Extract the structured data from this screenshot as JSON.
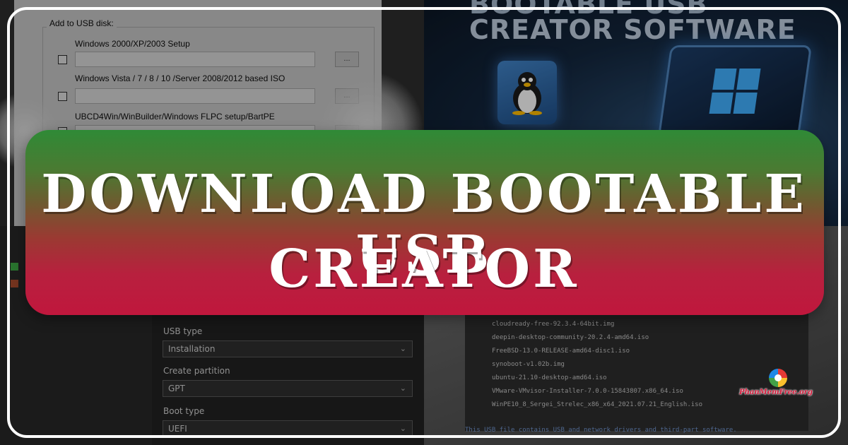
{
  "usb_disk_panel": {
    "group_title": "Add to USB disk:",
    "options": [
      {
        "label": "Windows 2000/XP/2003 Setup",
        "browse": "..."
      },
      {
        "label": "Windows Vista / 7 / 8 / 10 /Server 2008/2012 based ISO",
        "browse": "..."
      },
      {
        "label": "UBCD4Win/WinBuilder/Windows FLPC setup/BartPE",
        "browse": "..."
      }
    ]
  },
  "promo": {
    "title_top": "BOOTABLE USB",
    "title": "CREATOR SOFTWARE",
    "icons": [
      "linux-tux-icon",
      "windows-logo-icon"
    ]
  },
  "settings_panel": {
    "usb_type_label": "USB type",
    "usb_type_value": "Installation",
    "partition_label": "Create partition",
    "partition_value": "GPT",
    "boot_type_label": "Boot type",
    "boot_type_value": "UEFI",
    "legend_colors": {
      "green": "#3aa040",
      "brown": "#a0482c"
    }
  },
  "file_list": {
    "items": [
      "cloudready-free-92.3.4-64bit.img",
      "deepin-desktop-community-20.2.4-amd64.iso",
      "FreeBSD-13.0-RELEASE-amd64-disc1.iso",
      "synoboot-v1.02b.img",
      "ubuntu-21.10-desktop-amd64.iso",
      "VMware-VMvisor-Installer-7.0.0-15843807.x86_64.iso",
      "WinPE10_8_Sergei_Strelec_x86_x64_2021.07.21_English.iso"
    ],
    "footer": "This USB file contains USB and network drivers and third-part software."
  },
  "banner": {
    "line1": "DOWNLOAD BOOTABLE USB",
    "line2": "CREATOR",
    "gradient_top": "#2f8a36",
    "gradient_bottom": "#c0173d"
  },
  "watermark": {
    "text": "PhanMemFree.org"
  }
}
